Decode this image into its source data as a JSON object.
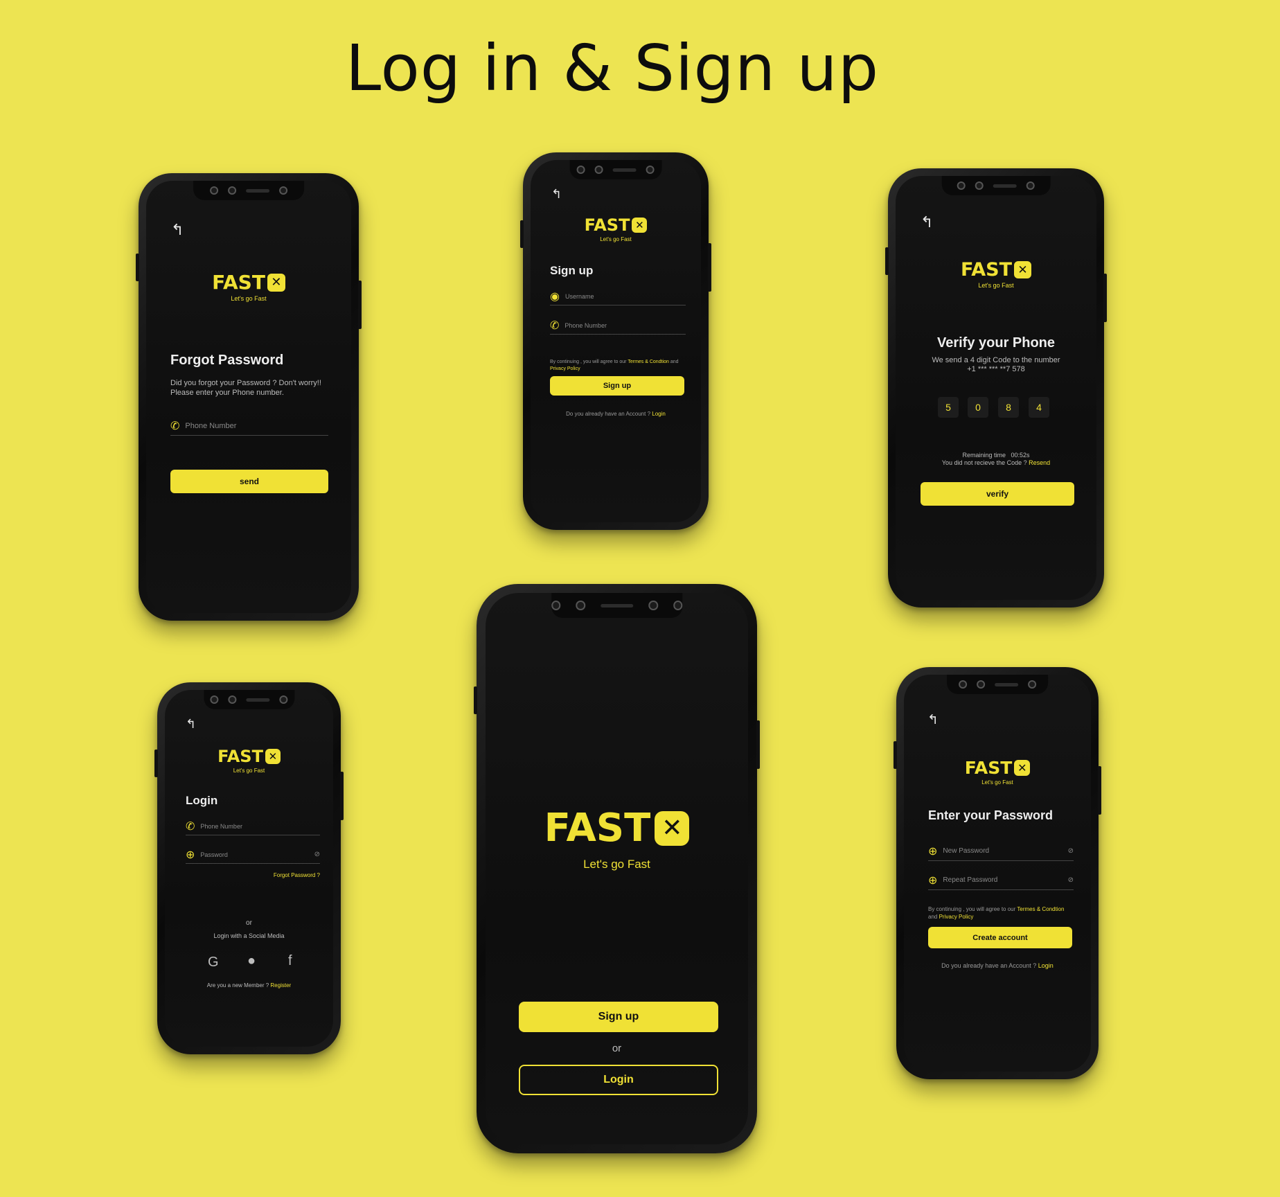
{
  "page_title": "Log in & Sign up",
  "brand": {
    "name": "FAST",
    "mark": "✕",
    "tagline": "Let's go Fast",
    "accent": "#f0e135",
    "background": "#ede452"
  },
  "back_icon": "back-arrow-icon",
  "forgot_password": {
    "title": "Forgot Password",
    "description": "Did you forgot your Password ? Don't worry!! Please enter your Phone number.",
    "phone_placeholder": "Phone Number",
    "send_label": "send"
  },
  "signup": {
    "title": "Sign up",
    "username_placeholder": "Username",
    "phone_placeholder": "Phone Number",
    "terms_prefix": "By continuing , you will  agree to our",
    "terms_link": "Termes & Condtion",
    "and": "and",
    "privacy_link": "Privacy Policy",
    "signup_label": "Sign up",
    "have_account": "Do you already have an Account ?",
    "login_link": "Login"
  },
  "verify": {
    "title": "Verify your Phone",
    "description": "We send a 4 digit Code to the number",
    "number": "+1 *** *** **7 578",
    "code": [
      "5",
      "0",
      "8",
      "4"
    ],
    "remaining_label": "Remaining time",
    "remaining_value": "00:52s",
    "not_received": "You did not recieve the Code ?",
    "resend_link": "Resend",
    "verify_label": "verify"
  },
  "login": {
    "title": "Login",
    "phone_placeholder": "Phone Number",
    "password_placeholder": "Password",
    "forgot_link": "Forgot Password ?",
    "or": "or",
    "social_label": "Login with a Social Media",
    "new_member": "Are you a new Member ?",
    "register_link": "Register"
  },
  "welcome": {
    "signup_label": "Sign up",
    "or": "or",
    "login_label": "Login"
  },
  "password": {
    "title": "Enter your Password",
    "new_placeholder": "New Password",
    "repeat_placeholder": "Repeat  Password",
    "terms_prefix": "By continuing , you will  agree to our",
    "terms_link": "Termes & Condtion",
    "and": "and",
    "privacy_link": "Privacy Policy",
    "create_label": "Create account",
    "have_account": "Do you already have an Account ?",
    "login_link": "Login"
  }
}
